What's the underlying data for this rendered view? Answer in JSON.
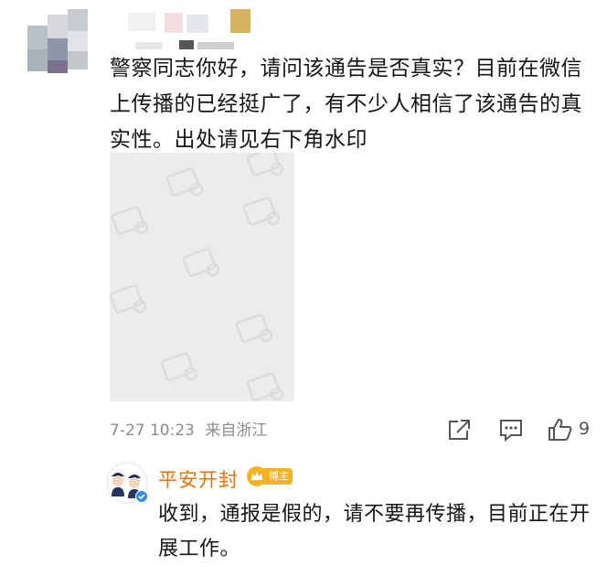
{
  "comment": {
    "text": "警察同志你好，请问该通告是否真实？目前在微信上传播的已经挺广了，有不少人相信了该通告的真实性。出处请见右下角水印",
    "date": "7-27 10:23",
    "source": "来自浙江",
    "like_count": "9"
  },
  "reply": {
    "author": "平安开封",
    "badge": "博主",
    "text": "收到，通报是假的，请不要再传播，目前正在开展工作。"
  },
  "icons": {
    "share": "share-icon",
    "comment": "comment-icon",
    "like": "thumbs-up-icon",
    "watermark": "image-placeholder-icon",
    "verified": "verified-badge-icon"
  },
  "colors": {
    "reply_author": "#e8710a",
    "badge": "#f5b324",
    "meta_text": "#8c8c8c",
    "placeholder_bg": "#ececec"
  }
}
